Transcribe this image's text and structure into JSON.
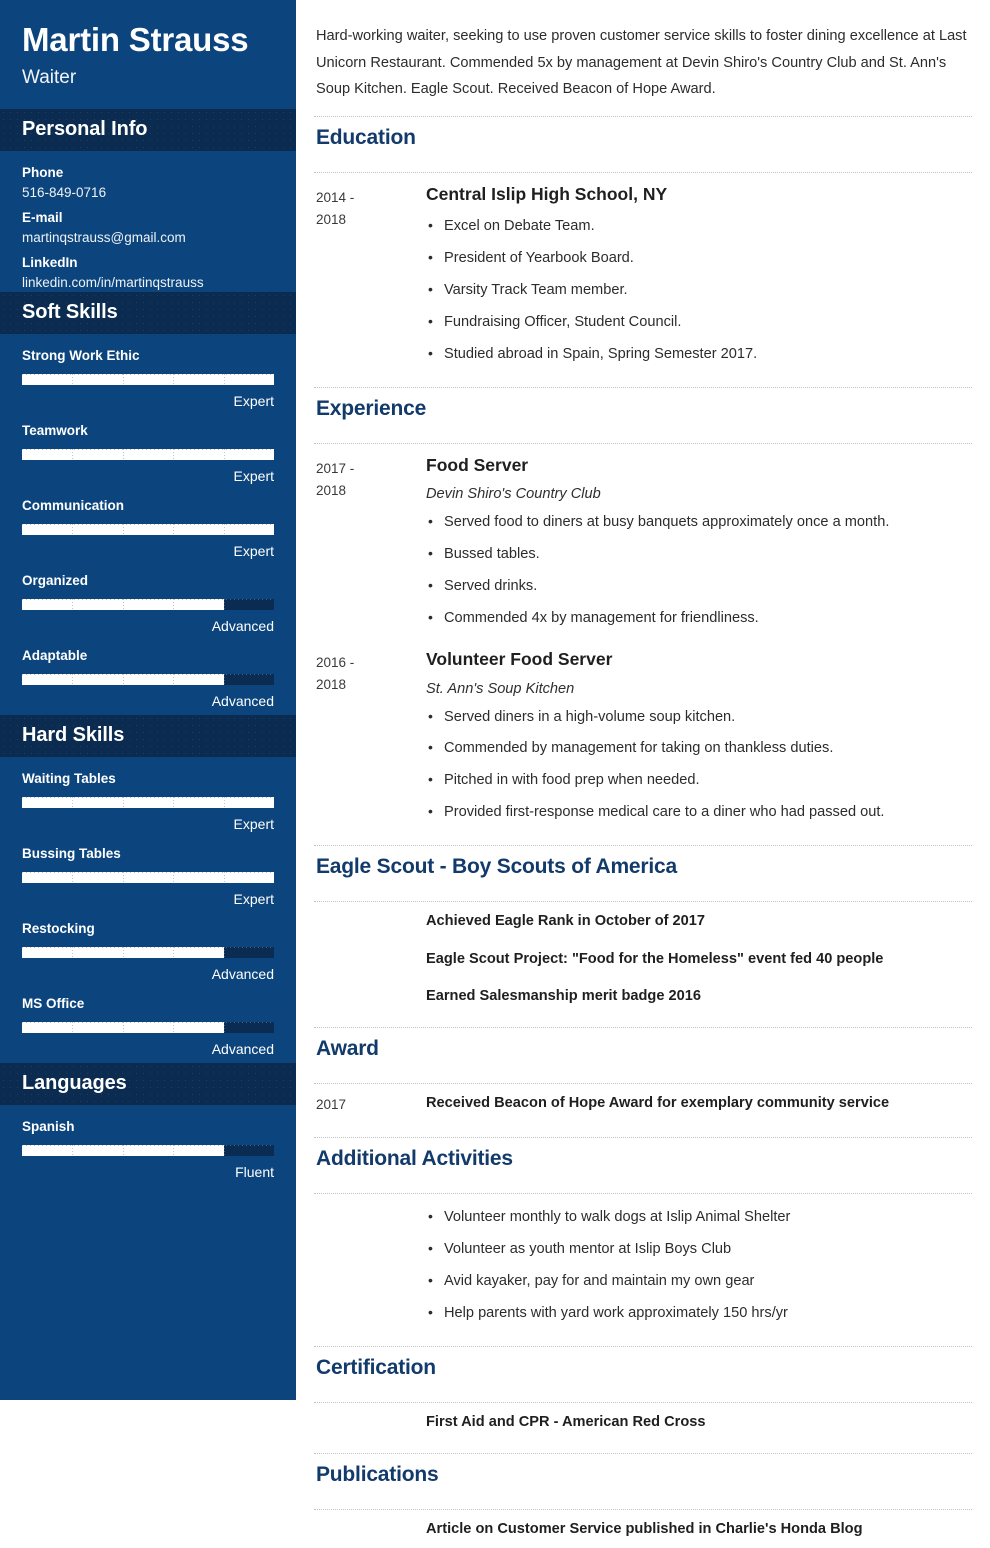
{
  "colors": {
    "sidebar_bg": "#0c457d",
    "sidebar_header_bg": "#0b2c50",
    "section_title": "#123a6b",
    "bar_fill": "#ffffff",
    "bar_track": "#0a2c52"
  },
  "header": {
    "name": "Martin Strauss",
    "job_title": "Waiter"
  },
  "sidebar": {
    "personal_info": {
      "heading": "Personal Info",
      "fields": [
        {
          "label": "Phone",
          "value": "516-849-0716"
        },
        {
          "label": "E-mail",
          "value": "martinqstrauss@gmail.com"
        },
        {
          "label": "LinkedIn",
          "value": "linkedin.com/in/martinqstrauss"
        }
      ]
    },
    "soft_skills": {
      "heading": "Soft Skills",
      "items": [
        {
          "name": "Strong Work Ethic",
          "level": "Expert",
          "percent": 100
        },
        {
          "name": "Teamwork",
          "level": "Expert",
          "percent": 100
        },
        {
          "name": "Communication",
          "level": "Expert",
          "percent": 100
        },
        {
          "name": "Organized",
          "level": "Advanced",
          "percent": 80
        },
        {
          "name": "Adaptable",
          "level": "Advanced",
          "percent": 80
        }
      ]
    },
    "hard_skills": {
      "heading": "Hard Skills",
      "items": [
        {
          "name": "Waiting Tables",
          "level": "Expert",
          "percent": 100
        },
        {
          "name": "Bussing Tables",
          "level": "Expert",
          "percent": 100
        },
        {
          "name": "Restocking",
          "level": "Advanced",
          "percent": 80
        },
        {
          "name": "MS Office",
          "level": "Advanced",
          "percent": 80
        }
      ]
    },
    "languages": {
      "heading": "Languages",
      "items": [
        {
          "name": "Spanish",
          "level": "Fluent",
          "percent": 80
        }
      ]
    }
  },
  "main": {
    "summary": "Hard-working waiter, seeking to use proven customer service skills to foster dining excellence at Last Unicorn Restaurant. Commended 5x by management at Devin Shiro's Country Club and St. Ann's Soup Kitchen. Eagle Scout. Received Beacon of Hope Award.",
    "education": {
      "title": "Education",
      "entries": [
        {
          "date_start": "2014 -",
          "date_end": "2018",
          "title": "Central Islip High School, NY",
          "bullets": [
            "Excel on Debate Team.",
            "President of Yearbook Board.",
            "Varsity Track Team member.",
            "Fundraising Officer, Student Council.",
            "Studied abroad in Spain, Spring Semester 2017."
          ]
        }
      ]
    },
    "experience": {
      "title": "Experience",
      "entries": [
        {
          "date_start": "2017 -",
          "date_end": "2018",
          "title": "Food Server",
          "subtitle": "Devin Shiro's Country Club",
          "bullets": [
            "Served food to diners at busy banquets approximately once a month.",
            "Bussed tables.",
            "Served drinks.",
            "Commended 4x by management for friendliness."
          ]
        },
        {
          "date_start": "2016 -",
          "date_end": "2018",
          "title": "Volunteer Food Server",
          "subtitle": "St. Ann's Soup Kitchen",
          "bullets": [
            "Served diners in a high-volume soup kitchen.",
            "Commended by management for taking on thankless duties.",
            "Pitched in with food prep when needed.",
            "Provided first-response medical care to a diner who had passed out."
          ]
        }
      ]
    },
    "eagle_scout": {
      "title": "Eagle Scout - Boy Scouts of America",
      "lines": [
        "Achieved Eagle Rank in October of 2017",
        "Eagle Scout Project: \"Food for the Homeless\" event fed 40 people",
        "Earned Salesmanship merit badge 2016"
      ]
    },
    "award": {
      "title": "Award",
      "date": "2017",
      "line": "Received Beacon of Hope Award for exemplary community service"
    },
    "additional_activities": {
      "title": "Additional Activities",
      "bullets": [
        "Volunteer monthly to walk dogs at Islip Animal Shelter",
        "Volunteer as youth mentor at Islip Boys Club",
        "Avid kayaker, pay for and maintain my own gear",
        "Help parents with yard work approximately 150 hrs/yr"
      ]
    },
    "certification": {
      "title": "Certification",
      "line": "First Aid and CPR - American Red Cross"
    },
    "publications": {
      "title": "Publications",
      "line": "Article on Customer Service published in Charlie's Honda Blog"
    }
  }
}
